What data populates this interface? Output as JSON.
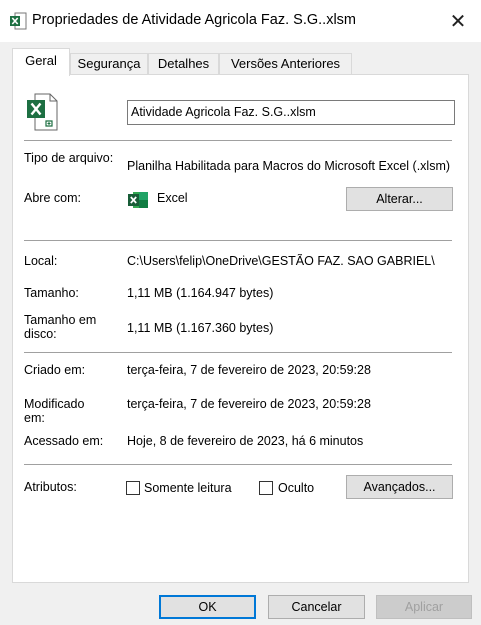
{
  "window": {
    "title": "Propriedades de Atividade Agricola Faz. S.G..xlsm",
    "close_glyph": "✕"
  },
  "tabs": [
    {
      "label": "Geral",
      "active": true
    },
    {
      "label": "Segurança",
      "active": false
    },
    {
      "label": "Detalhes",
      "active": false
    },
    {
      "label": "Versões Anteriores",
      "active": false
    }
  ],
  "general": {
    "filename": "Atividade Agricola Faz. S.G..xlsm",
    "type_label": "Tipo de arquivo:",
    "type_value": "Planilha Habilitada para Macros do Microsoft Excel (.xlsm)",
    "opens_with_label": "Abre com:",
    "opens_with_value": "Excel",
    "change_button": "Alterar...",
    "location_label": "Local:",
    "location_value": "C:\\Users\\felip\\OneDrive\\GESTÃO FAZ. SAO GABRIEL\\",
    "size_label": "Tamanho:",
    "size_value": "1,11 MB (1.164.947 bytes)",
    "size_on_disk_label": "Tamanho em disco:",
    "size_on_disk_value": "1,11 MB (1.167.360 bytes)",
    "created_label": "Criado em:",
    "created_value": "terça-feira, 7 de fevereiro de 2023, 20:59:28",
    "modified_label": "Modificado em:",
    "modified_value": "terça-feira, 7 de fevereiro de 2023, 20:59:28",
    "accessed_label": "Acessado em:",
    "accessed_value": "Hoje, 8 de fevereiro de 2023, há 6 minutos",
    "attributes_label": "Atributos:",
    "readonly_label": "Somente leitura",
    "hidden_label": "Oculto",
    "advanced_button": "Avançados..."
  },
  "footer": {
    "ok": "OK",
    "cancel": "Cancelar",
    "apply": "Aplicar"
  },
  "colors": {
    "excel_green": "#1d6f42",
    "focus_blue": "#0078d7"
  },
  "icons": {
    "title": "excel-file-icon",
    "file": "excel-macro-file-icon",
    "app": "excel-app-icon"
  }
}
